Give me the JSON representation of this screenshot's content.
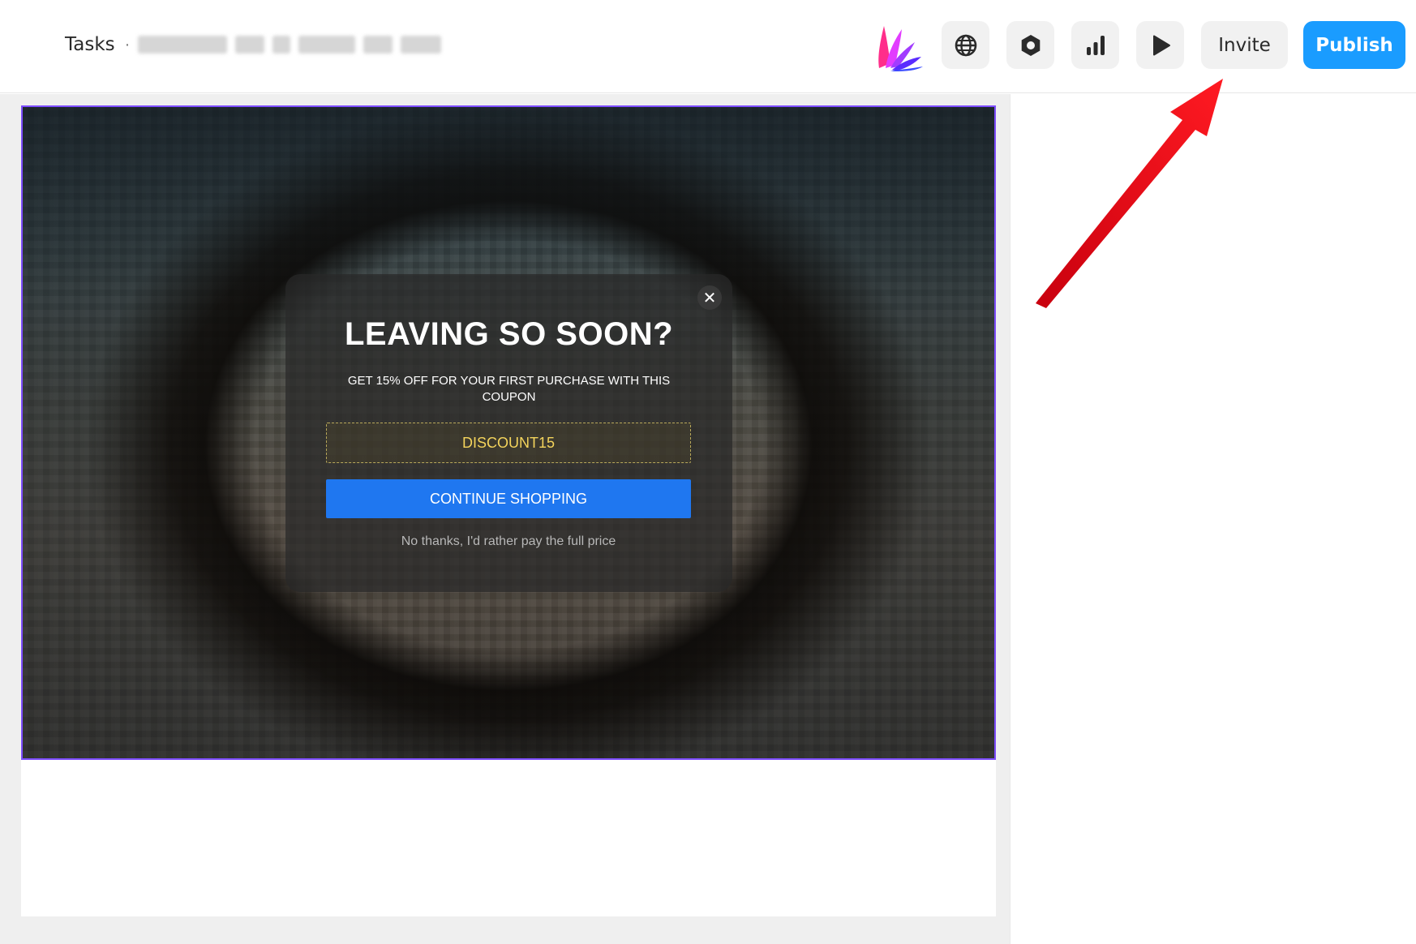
{
  "header": {
    "breadcrumb_title": "Tasks",
    "breadcrumb_separator": "·",
    "logo_icon": "brand-fan-logo-icon",
    "toolbar_icons": [
      "globe-icon",
      "settings-hexagon-icon",
      "bar-chart-icon",
      "play-icon"
    ],
    "invite_label": "Invite",
    "publish_label": "Publish",
    "publish_color": "#1a9cff"
  },
  "popup": {
    "title": "LEAVING SO SOON?",
    "subtitle": "GET 15% OFF FOR YOUR FIRST PURCHASE WITH THIS COUPON",
    "coupon_code": "DISCOUNT15",
    "cta_label": "CONTINUE SHOPPING",
    "decline_label": "No thanks, I'd rather pay the full price",
    "close_symbol": "✕",
    "coupon_color": "#f4d45c",
    "cta_color": "#1f77f0"
  },
  "canvas": {
    "selection_color": "#7d4dff"
  },
  "annotation": {
    "arrow_color": "#e8101a"
  }
}
